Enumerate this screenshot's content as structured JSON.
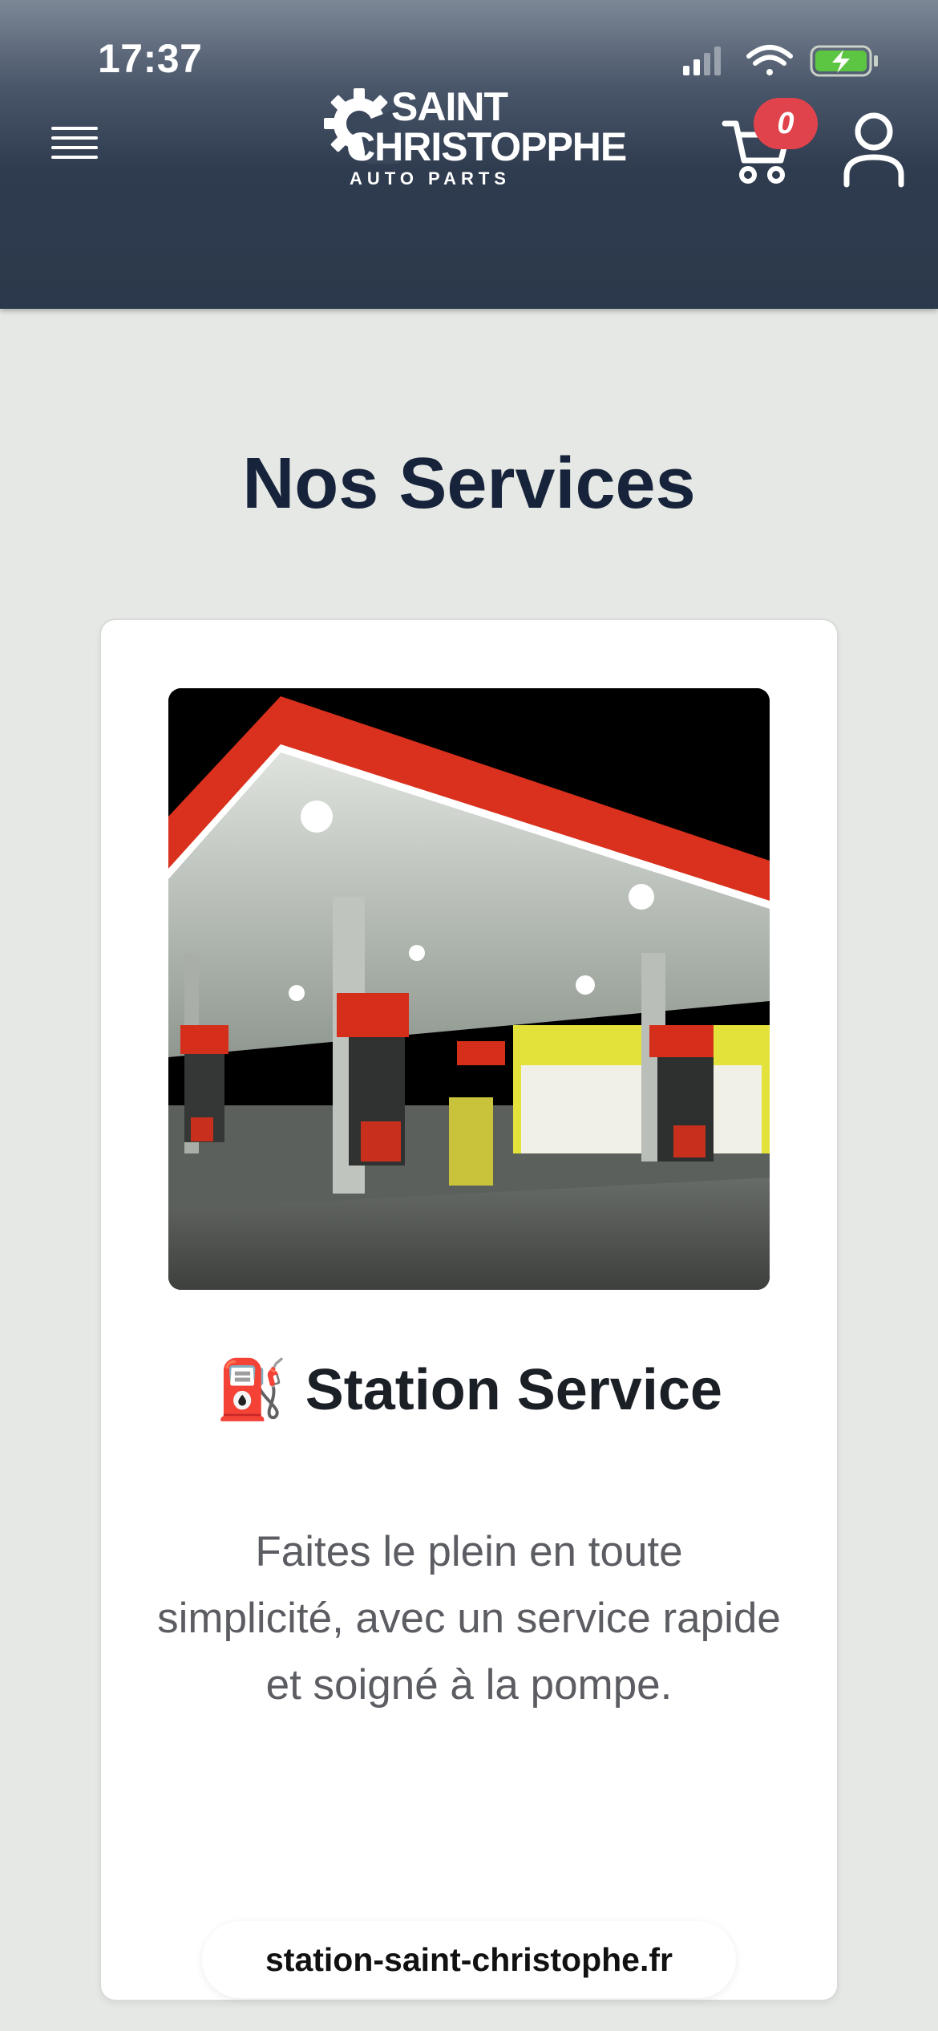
{
  "status_bar": {
    "time": "17:37",
    "icons": [
      "signal-icon",
      "wifi-icon",
      "battery-charging-icon"
    ]
  },
  "header": {
    "menu_icon": "hamburger-menu-icon",
    "logo": {
      "line1": "SAINT",
      "line2": "CHRISTOPPHE",
      "subtitle": "AUTO PARTS",
      "icon": "gear-icon"
    },
    "cart": {
      "icon": "cart-icon",
      "count": "0"
    },
    "account_icon": "user-icon"
  },
  "main": {
    "title": "Nos Services",
    "services": [
      {
        "image": "gas-station-photo",
        "emoji": "⛽",
        "title": "Station Service",
        "description": "Faites le plein en toute simplicité, avec un service rapide et soigné à la pompe."
      }
    ]
  },
  "browser": {
    "url": "station-saint-christophe.fr"
  },
  "colors": {
    "header_bg": "#2c394c",
    "page_bg": "#e6e8e5",
    "title_text": "#16233a",
    "badge_red": "#e0434b",
    "card_bg": "#ffffff"
  }
}
